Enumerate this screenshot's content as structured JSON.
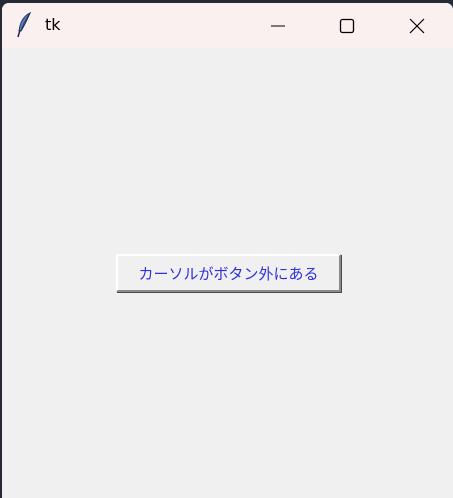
{
  "window": {
    "title": "tk"
  },
  "titlebar": {
    "icons": {
      "app": "feather-icon",
      "minimize": "minimize-icon",
      "maximize": "maximize-icon",
      "close": "close-icon"
    }
  },
  "content": {
    "button_label": "カーソルがボタン外にある",
    "button_text_color": "#2f2fe0"
  },
  "colors": {
    "titlebar_bg": "#faf0f0",
    "window_bg": "#f0f0f0",
    "desktop_bg": "#262b33"
  }
}
